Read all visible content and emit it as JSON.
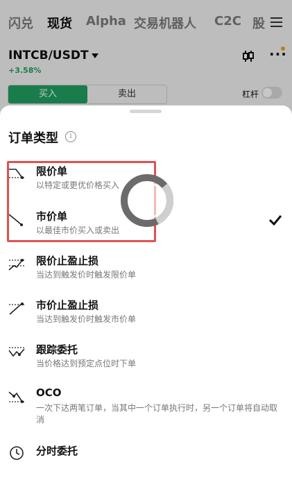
{
  "nav": {
    "tabs": [
      "闪兑",
      "现货",
      "Alpha",
      "交易机器人",
      "C2C",
      "股"
    ],
    "active": "现货"
  },
  "market": {
    "pair": "INTCB/USDT",
    "change": "+3.58%"
  },
  "trade": {
    "buy_label": "买入",
    "sell_label": "卖出",
    "leverage_label": "杠杆"
  },
  "colors": {
    "accent_green": "#1fa060",
    "highlight_red": "#e05050"
  },
  "sheet": {
    "title": "订单类型",
    "info_icon": "i",
    "items": [
      {
        "title": "限价单",
        "desc": "以特定或更优价格买入",
        "icon": "limit-order-icon",
        "selected": false
      },
      {
        "title": "市价单",
        "desc": "以最佳市价买入或卖出",
        "icon": "market-order-icon",
        "selected": true
      },
      {
        "title": "限价止盈止损",
        "desc": "当达到触发价时触发限价单",
        "icon": "stop-limit-icon",
        "selected": false
      },
      {
        "title": "市价止盈止损",
        "desc": "当达到触发价时触发市价单",
        "icon": "stop-market-icon",
        "selected": false
      },
      {
        "title": "跟踪委托",
        "desc": "当价格达到预定点位时下单",
        "icon": "trailing-order-icon",
        "selected": false
      },
      {
        "title": "OCO",
        "desc": "一次下达两笔订单，当其中一个订单执行时，另一个订单将自动取消",
        "icon": "oco-icon",
        "selected": false
      },
      {
        "title": "分时委托",
        "desc": "",
        "icon": "twap-icon",
        "selected": false
      }
    ]
  }
}
